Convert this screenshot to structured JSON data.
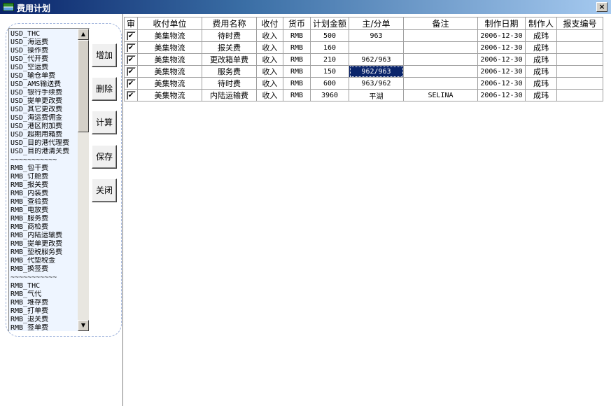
{
  "window": {
    "title": "费用计划",
    "close_glyph": "×"
  },
  "fee_list": {
    "usd_items": [
      "USD_THC",
      "USD_海运费",
      "USD_操作费",
      "USD_代开费",
      "USD_空运费",
      "USD_输仓单费",
      "USD_AMS输送费",
      "USD_银行手续费",
      "USD_提单更改费",
      "USD_其它更改费",
      "USD_海运费佣金",
      "USD_港区附加费",
      "USD_超期用箱费",
      "USD_目的港代理费",
      "USD_目的港清关费"
    ],
    "separator_1": "~~~~~~~~~~~",
    "rmb_items": [
      "RMB_包干费",
      "RMB_订舱费",
      "RMB_报关费",
      "RMB_内装费",
      "RMB_查验费",
      "RMB_电放费",
      "RMB_服务费",
      "RMB_商检费",
      "RMB_内陆运输费",
      "RMB_提单更改费",
      "RMB_垫税服务费",
      "RMB_代垫税金",
      "RMB_换签费"
    ],
    "separator_2": "~~~~~~~~~~~",
    "rmb_items_2": [
      "RMB_THC",
      "RMB_气代",
      "RMB_堆存费",
      "RMB_打单费",
      "RMB_退关费",
      "RMB_签单费"
    ]
  },
  "buttons": {
    "add": "增加",
    "delete": "删除",
    "calculate": "计算",
    "save": "保存",
    "close": "关闭"
  },
  "table": {
    "headers": [
      "审",
      "收付单位",
      "费用名称",
      "收付",
      "货币",
      "计划金额",
      "主/分单",
      "备注",
      "制作日期",
      "制作人",
      "报支编号"
    ],
    "check_glyph": "✔",
    "rows": [
      {
        "audit": true,
        "unit": "美集物流",
        "fee": "待时费",
        "pay": "收入",
        "currency": "RMB",
        "amount": "500",
        "bill": "963",
        "note": "",
        "date": "2006-12-30",
        "maker": "成玮",
        "report_no": ""
      },
      {
        "audit": true,
        "unit": "美集物流",
        "fee": "报关费",
        "pay": "收入",
        "currency": "RMB",
        "amount": "160",
        "bill": "",
        "note": "",
        "date": "2006-12-30",
        "maker": "成玮",
        "report_no": ""
      },
      {
        "audit": true,
        "unit": "美集物流",
        "fee": "更改箱单费",
        "pay": "收入",
        "currency": "RMB",
        "amount": "210",
        "bill": "962/963",
        "note": "",
        "date": "2006-12-30",
        "maker": "成玮",
        "report_no": ""
      },
      {
        "audit": true,
        "unit": "美集物流",
        "fee": "服务费",
        "pay": "收入",
        "currency": "RMB",
        "amount": "150",
        "bill": "962/963",
        "note": "",
        "date": "2006-12-30",
        "maker": "成玮",
        "report_no": "",
        "selected_cell": "bill"
      },
      {
        "audit": true,
        "unit": "美集物流",
        "fee": "待时费",
        "pay": "收入",
        "currency": "RMB",
        "amount": "600",
        "bill": "963/962",
        "note": "",
        "date": "2006-12-30",
        "maker": "成玮",
        "report_no": ""
      },
      {
        "audit": true,
        "unit": "美集物流",
        "fee": "内陆运输费",
        "pay": "收入",
        "currency": "RMB",
        "amount": "3960",
        "bill": "平湖",
        "note": "SELINA",
        "date": "2006-12-30",
        "maker": "成玮",
        "report_no": ""
      }
    ]
  },
  "colors": {
    "titlebar": "#0a246a",
    "selection": "#0a246a",
    "list_background": "#eef5ff"
  }
}
